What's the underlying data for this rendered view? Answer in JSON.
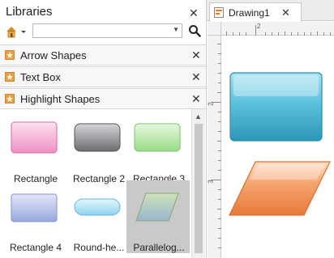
{
  "libraries": {
    "title": "Libraries",
    "close_glyph": "✕",
    "search": {
      "value": "",
      "placeholder": ""
    },
    "categories": [
      {
        "label": "Arrow Shapes"
      },
      {
        "label": "Text Box"
      },
      {
        "label": "Highlight Shapes"
      }
    ],
    "shapes": [
      {
        "label": "Rectangle",
        "color": "#f4a8d0"
      },
      {
        "label": "Rectangle 2",
        "color": "#9a9a9e"
      },
      {
        "label": "Rectangle 3",
        "color": "#b6e6a8"
      },
      {
        "label": "Rectangle 4",
        "color": "#b3bde6"
      },
      {
        "label": "Round-he...",
        "color": "#a8dcf2"
      },
      {
        "label": "Parallelog...",
        "color": "#b9cfa4"
      }
    ]
  },
  "document": {
    "tab_label": "Drawing1",
    "tab_close_glyph": "✕",
    "ruler": {
      "h_label": "2",
      "v_labels": [
        "2",
        "3"
      ]
    },
    "canvas_shapes": [
      {
        "kind": "rectangle",
        "color": "#4bb7d4"
      },
      {
        "kind": "parallelogram",
        "color": "#f0935a"
      }
    ]
  },
  "colors": {
    "accent_orange": "#e67e22",
    "panel_border": "#d6d6d6"
  },
  "icons": [
    "home-icon",
    "search-icon",
    "close-icon",
    "library-category-icon",
    "drawing-icon"
  ]
}
